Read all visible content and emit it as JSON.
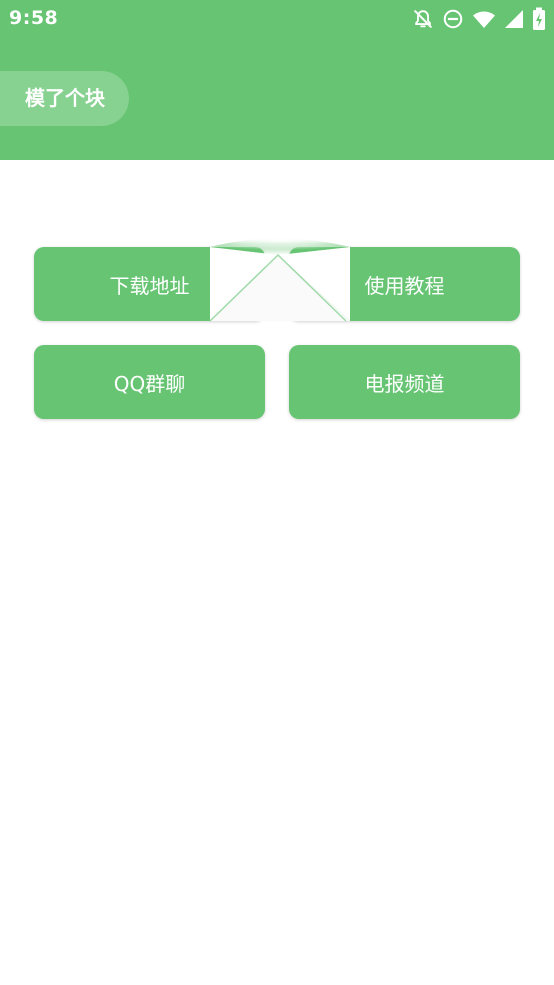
{
  "status_bar": {
    "time": "9:58",
    "icons": [
      "notifications-off-icon",
      "do-not-disturb-icon",
      "wifi-icon",
      "cell-signal-icon",
      "battery-charging-icon"
    ]
  },
  "header": {
    "title": "模了个块",
    "color": "#66c473"
  },
  "buttons": {
    "download": "下载地址",
    "tutorial": "使用教程",
    "qq_group": "QQ群聊",
    "telegram": "电报频道"
  },
  "colors": {
    "accent": "#66c473",
    "background": "#ffffff",
    "text_on_accent": "#ffffff"
  }
}
